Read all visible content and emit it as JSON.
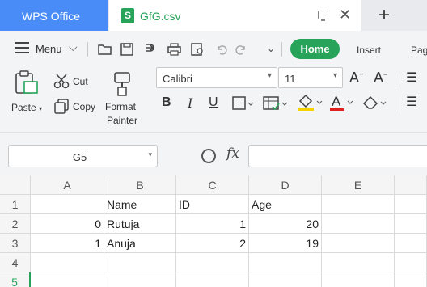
{
  "titlebar": {
    "app_tab": "WPS Office",
    "doc_tab": "GfG.csv",
    "doc_icon_letter": "S",
    "new_tab": "+"
  },
  "menubar": {
    "menu_label": "Menu",
    "tabs": [
      "Home",
      "Insert",
      "Pag"
    ]
  },
  "ribbon": {
    "paste": "Paste",
    "cut": "Cut",
    "copy": "Copy",
    "format_painter_line1": "Format",
    "format_painter_line2": "Painter",
    "font_name": "Calibri",
    "font_size": "11",
    "bold": "B",
    "italic": "I",
    "underline": "U",
    "font_color_letter": "A",
    "accent_color": "#27a35a",
    "highlight_color": "#f5d200",
    "font_color": "#e02020"
  },
  "formulabar": {
    "name_box": "G5",
    "fx": "fx",
    "formula": ""
  },
  "sheet": {
    "columns": [
      "A",
      "B",
      "C",
      "D",
      "E"
    ],
    "rows": [
      "1",
      "2",
      "3",
      "4",
      "5"
    ],
    "cells": {
      "B1": "Name",
      "C1": "ID",
      "D1": "Age",
      "A2": "0",
      "B2": "Rutuja",
      "C2": "1",
      "D2": "20",
      "A3": "1",
      "B3": "Anuja",
      "C3": "2",
      "D3": "19"
    }
  }
}
